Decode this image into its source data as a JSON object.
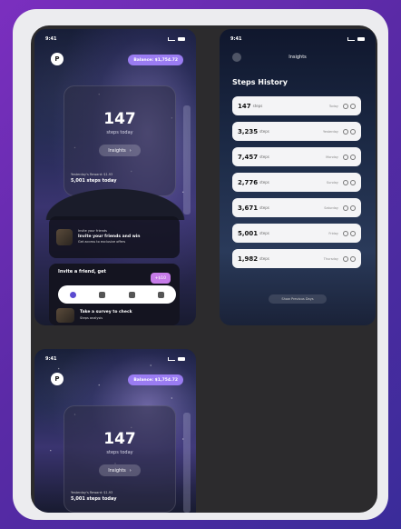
{
  "phone_home": {
    "time": "9:41",
    "avatar_initial": "P",
    "balance": "Balance: $1,754.72",
    "steps_value": "147",
    "steps_label": "steps today",
    "insights_label": "Insights",
    "yesterday_label": "Yesterday's Reward: $1.93",
    "yesterday_steps": "5,001 steps today",
    "challenge": {
      "eyebrow": "Invite your friends",
      "title": "Invite your friends and win",
      "subtitle": "Get access to exclusive offers"
    },
    "invite_title": "Invite a friend, get",
    "invite_reward": "+$10",
    "story": {
      "title": "Take a survey to check",
      "subtitle": "Steps analysis"
    }
  },
  "phone_history": {
    "time": "9:41",
    "header": "Insights",
    "title": "Steps History",
    "rows": [
      {
        "value": "147",
        "unit": "steps",
        "date": "Today"
      },
      {
        "value": "3,235",
        "unit": "steps",
        "date": "Yesterday"
      },
      {
        "value": "7,457",
        "unit": "steps",
        "date": "Monday"
      },
      {
        "value": "2,776",
        "unit": "steps",
        "date": "Sunday"
      },
      {
        "value": "3,671",
        "unit": "steps",
        "date": "Saturday"
      },
      {
        "value": "5,001",
        "unit": "steps",
        "date": "Friday"
      },
      {
        "value": "1,982",
        "unit": "steps",
        "date": "Thursday"
      }
    ],
    "show_more": "Show Previous Days"
  },
  "phone_home_copy": {
    "time": "9:41",
    "avatar_initial": "P",
    "balance": "Balance: $1,754.72",
    "steps_value": "147",
    "steps_label": "steps today",
    "insights_label": "Insights",
    "yesterday_label": "Yesterday's Reward: $1.93",
    "yesterday_steps": "5,001 steps today"
  }
}
